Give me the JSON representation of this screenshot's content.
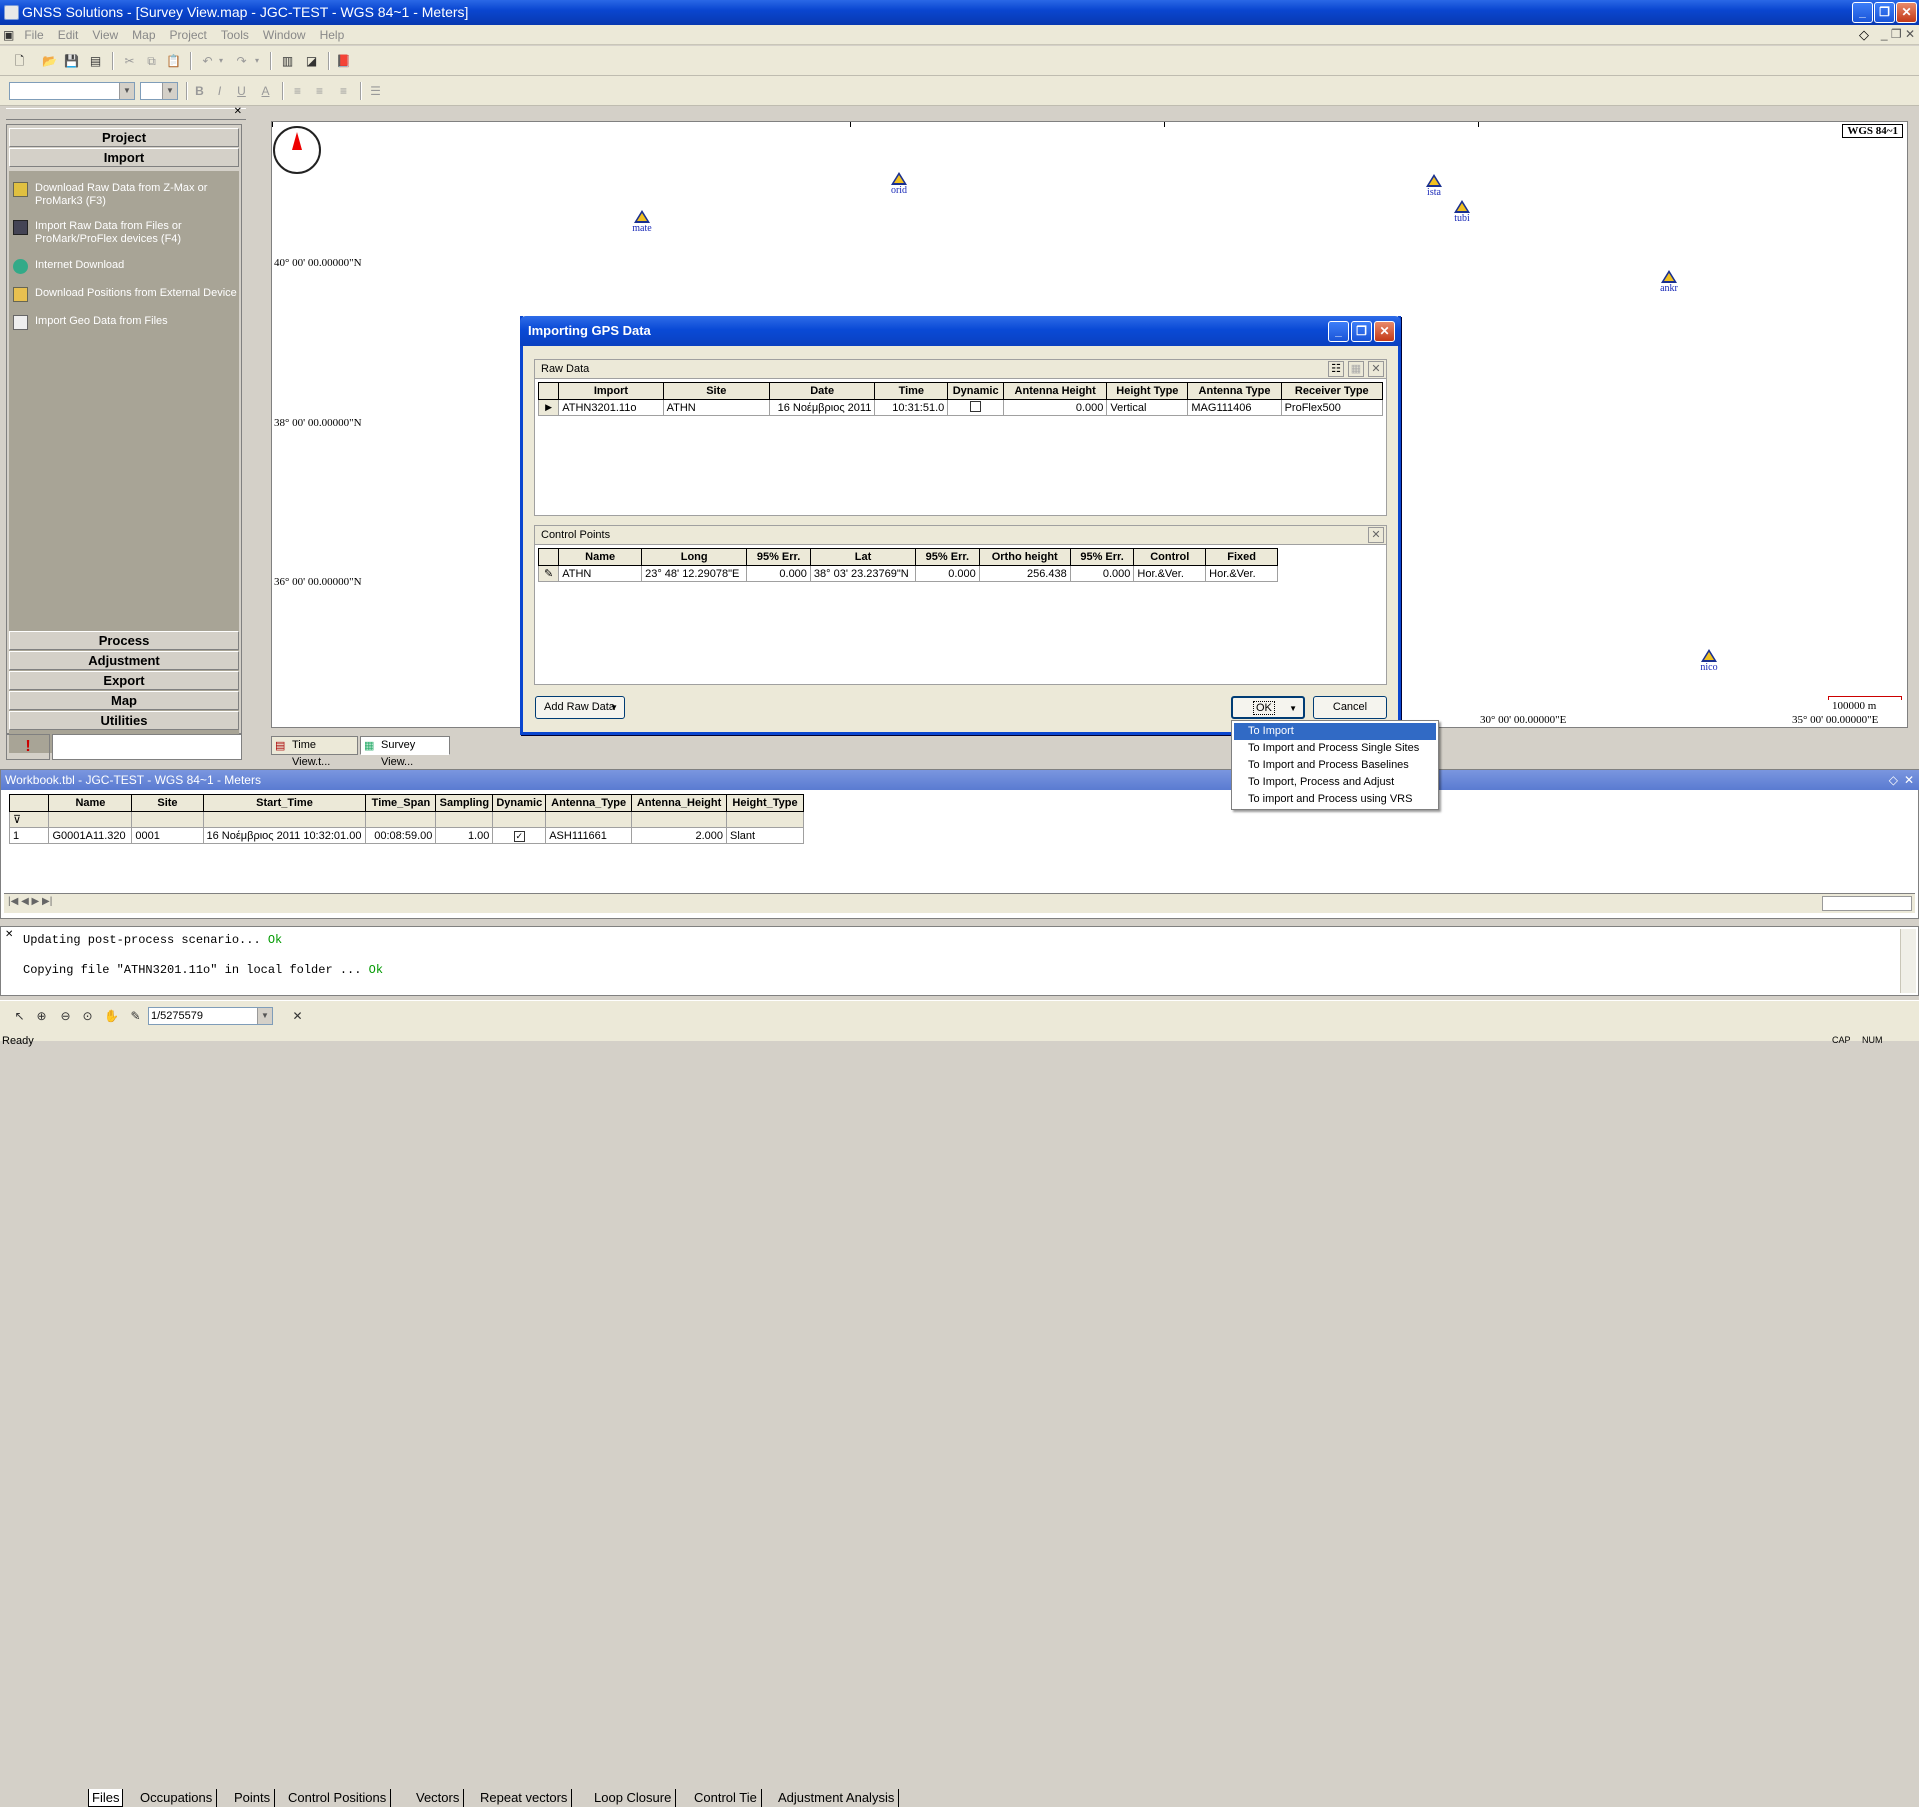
{
  "window": {
    "title": "GNSS Solutions - [Survey View.map - JGC-TEST - WGS 84~1 - Meters]",
    "minimize": "_",
    "maximize": "❐",
    "close": "✕"
  },
  "menu": [
    "File",
    "Edit",
    "View",
    "Map",
    "Project",
    "Tools",
    "Window",
    "Help"
  ],
  "toolbar": {
    "font_combo": "",
    "size_combo": "",
    "bold": "B",
    "italic": "I",
    "underline": "U",
    "font_color": "A"
  },
  "left_panel": {
    "top_buttons": [
      "Project",
      "Import"
    ],
    "tasks": [
      {
        "label": "Download Raw Data from Z-Max or ProMark3 (F3)",
        "icon": "download-icon"
      },
      {
        "label": "Import Raw Data from Files or ProMark/ProFlex devices (F4)",
        "icon": "import-icon"
      },
      {
        "label": "Internet Download",
        "icon": "globe-icon"
      },
      {
        "label": "Download Positions from External Device",
        "icon": "folder-icon"
      },
      {
        "label": "Import Geo Data from Files",
        "icon": "file-icon"
      }
    ],
    "bottom_buttons": [
      "Process",
      "Adjustment",
      "Export",
      "Map",
      "Utilities"
    ],
    "alert_icon": "!"
  },
  "map": {
    "datum_label": "WGS 84~1",
    "latitudes": [
      "40° 00' 00.00000\"N",
      "38° 00' 00.00000\"N",
      "36° 00' 00.00000\"N"
    ],
    "longitudes": [
      "30° 00' 00.00000\"E",
      "35° 00' 00.00000\"E"
    ],
    "scale": "100000 m",
    "stations": [
      "mate",
      "orid",
      "ista",
      "tubi",
      "ankr",
      "nico"
    ]
  },
  "view_tabs": [
    "Time View.t...",
    "Survey View..."
  ],
  "dialog": {
    "title": "Importing GPS Data",
    "raw_data": {
      "header": "Raw Data",
      "columns": [
        "Import",
        "Site",
        "Date",
        "Time",
        "Dynamic",
        "Antenna Height",
        "Height Type",
        "Antenna Type",
        "Receiver Type"
      ],
      "rows": [
        [
          "ATHN3201.11o",
          "ATHN",
          "16 Νοέμβριος 2011",
          "10:31:51.0",
          "",
          "0.000",
          "Vertical",
          "MAG111406",
          "ProFlex500"
        ]
      ]
    },
    "control_points": {
      "header": "Control Points",
      "columns": [
        "Name",
        "Long",
        "95% Err.",
        "Lat",
        "95% Err.",
        "Ortho height",
        "95% Err.",
        "Control",
        "Fixed"
      ],
      "rows": [
        [
          "ATHN",
          "23° 48' 12.29078\"E",
          "0.000",
          "38° 03' 23.23769\"N",
          "0.000",
          "256.438",
          "0.000",
          "Hor.&Ver.",
          "Hor.&Ver."
        ]
      ]
    },
    "add_raw_data": "Add Raw Data",
    "ok": "OK",
    "cancel": "Cancel",
    "ok_menu": [
      "To Import",
      "To Import and Process Single Sites",
      "To Import and Process Baselines",
      "To Import, Process and Adjust",
      "To import and Process using VRS"
    ]
  },
  "workbook": {
    "title": "Workbook.tbl - JGC-TEST - WGS 84~1 - Meters",
    "columns": [
      "Name",
      "Site",
      "Start_Time",
      "Time_Span",
      "Sampling",
      "Dynamic",
      "Antenna_Type",
      "Antenna_Height",
      "Height_Type"
    ],
    "rows": [
      [
        "1",
        "G0001A11.320",
        "0001",
        "16 Νοέμβριος 2011 10:32:01.00",
        "00:08:59.00",
        "1.00",
        "",
        "ASH111661",
        "2.000",
        "Slant"
      ]
    ],
    "sheet_tabs": [
      "Files",
      "Occupations",
      "Points",
      "Control Positions",
      "Vectors",
      "Repeat vectors",
      "Loop Closure",
      "Control Tie",
      "Adjustment Analysis"
    ]
  },
  "log": [
    {
      "text": "Updating post-process scenario...",
      "status": "Ok"
    },
    {
      "text": "Copying file \"ATHN3201.11o\" in local folder ...",
      "status": "Ok"
    }
  ],
  "bottom_toolbar": {
    "scale_value": "1/5275579"
  },
  "status": {
    "left": "Ready",
    "cap": "CAP",
    "num": "NUM"
  }
}
